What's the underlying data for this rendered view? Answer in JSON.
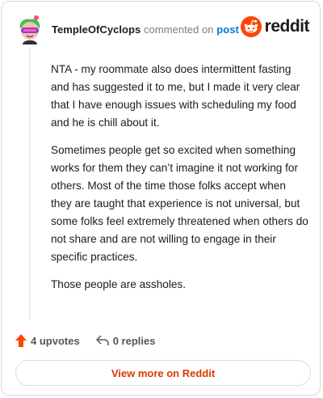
{
  "comment": {
    "author": "TempleOfCyclops",
    "action_text": "commented on",
    "post_link": "post",
    "paragraphs": [
      "NTA - my roommate also does intermittent fasting and has suggested it to me, but I made it very clear that I have enough issues with scheduling my food and he is chill about it.",
      "Sometimes people get so excited when something works for them they can’t imagine it not working for others. Most of the time those folks accept when they are taught that experience is not universal, but some folks feel extremely threatened when others do not share and are not willing to engage in their specific practices.",
      "Those people are assholes."
    ],
    "upvotes": "4 upvotes",
    "replies": "0 replies"
  },
  "brand": {
    "name": "reddit",
    "color": "#ff4500"
  },
  "footer": {
    "view_more": "View more on Reddit"
  },
  "colors": {
    "upvote": "#ff4500",
    "link": "#0079d3",
    "view_more": "#d93a00"
  },
  "icons": {
    "avatar": "snoo-avatar-icon",
    "brand": "reddit-logo-icon",
    "upvote": "upvote-arrow-icon",
    "reply": "reply-arrow-icon"
  }
}
